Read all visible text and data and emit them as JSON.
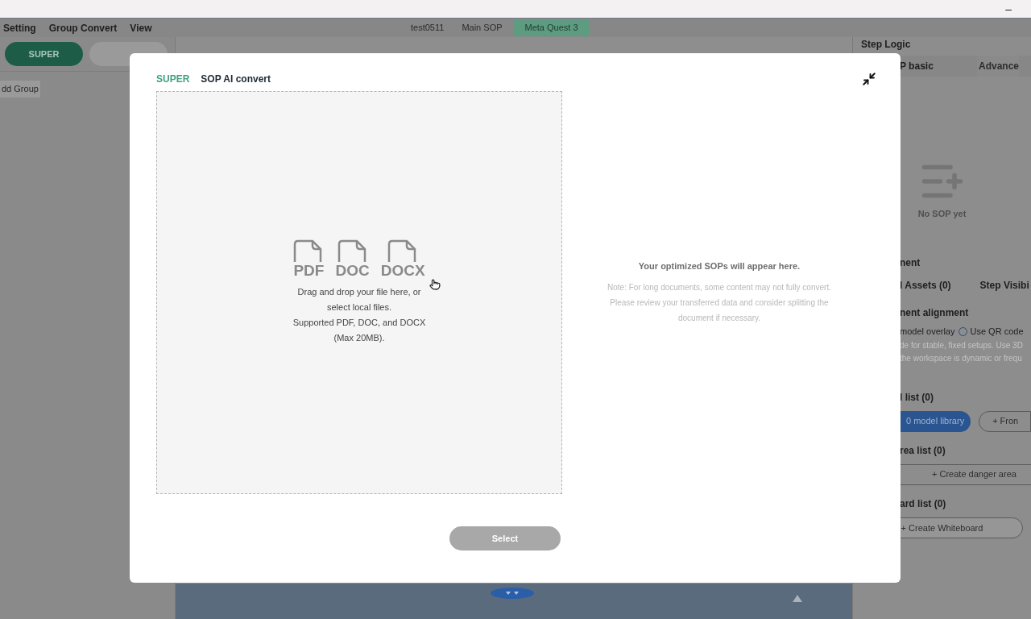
{
  "window": {
    "minimize": "–"
  },
  "menu": [
    "Setting",
    "Group Convert",
    "View"
  ],
  "tabs": [
    {
      "label": "test0511",
      "selected": false
    },
    {
      "label": "Main SOP",
      "selected": false
    },
    {
      "label": "Meta Quest 3",
      "selected": true
    }
  ],
  "sidebar": {
    "buttons": [
      {
        "label": "SUPER",
        "selected": true
      },
      {
        "selected": false
      }
    ],
    "add_group": "dd Group"
  },
  "right_panel": {
    "title": "Step Logic",
    "tabs": [
      {
        "label": "P basic",
        "selected": true
      },
      {
        "label": "Advance",
        "selected": false
      }
    ],
    "empty": "No SOP yet",
    "section": "nent",
    "asset_tabs": [
      "l Assets (0)",
      "Step Visibi"
    ],
    "alignment_title": "nent alignment",
    "overlay_label": "model overlay",
    "radio": {
      "label": "Use QR code",
      "selected": false
    },
    "hints": [
      "de for stable, fixed setups. Use 3D",
      "the workspace is dynamic or frequ"
    ],
    "model_list": "l list (0)",
    "model_buttons": [
      {
        "label": "0 model library",
        "kind": "primary"
      },
      {
        "label": "+ Fron",
        "kind": "outline"
      }
    ],
    "danger_list": "rea list (0)",
    "danger_button": "+ Create danger area",
    "board_list": "ard list (0)",
    "board_button": "+ Create Whiteboard"
  },
  "modal": {
    "brand": "SUPER",
    "title": "SOP AI convert",
    "file_types": [
      "PDF",
      "DOC",
      "DOCX"
    ],
    "drop_lines": [
      "Drag and drop your file here, or",
      "select local files.",
      "Supported PDF, DOC, and DOCX",
      "(Max 20MB)."
    ],
    "result_title": "Your optimized SOPs will appear here.",
    "note": "Note: For long documents, some content may not fully convert. Please review your transferred data and consider splitting the document if necessary.",
    "select": {
      "label": "Select",
      "disabled": true
    }
  }
}
